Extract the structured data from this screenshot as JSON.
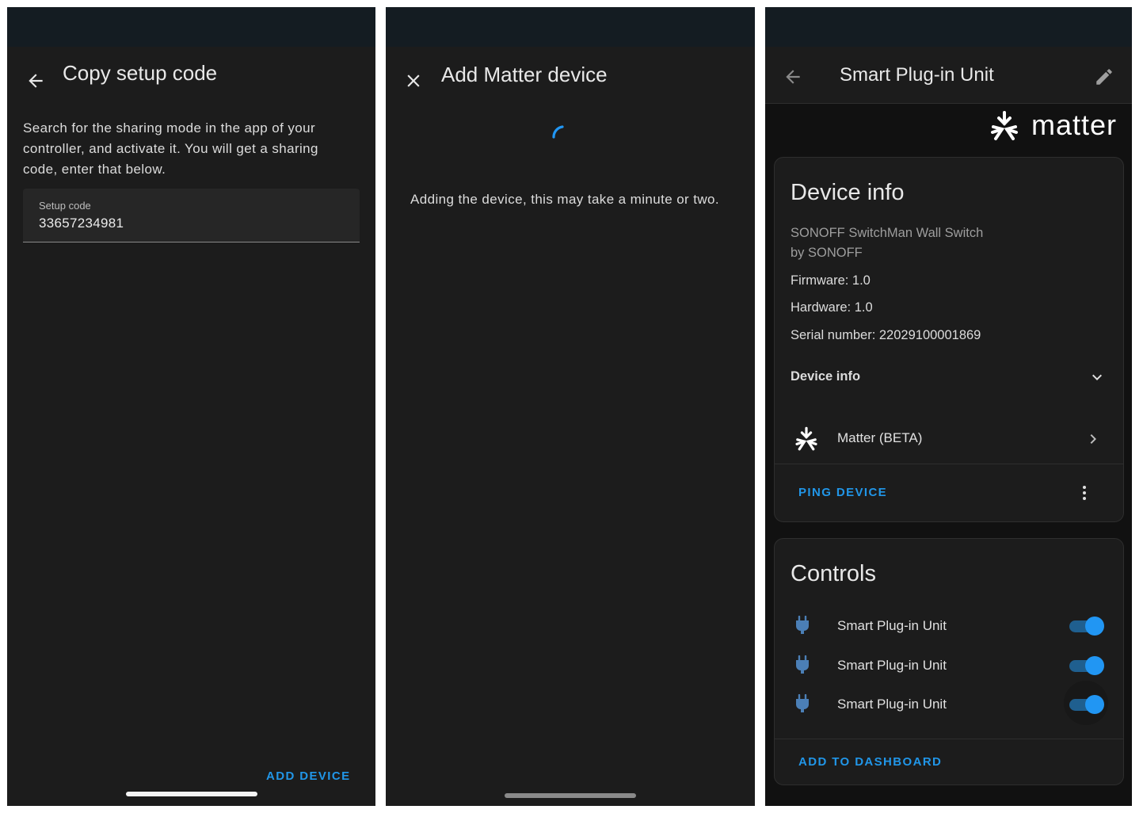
{
  "screen1": {
    "title": "Copy setup code",
    "description": "Search for the sharing mode in the app of your controller, and activate it. You will get a sharing code, enter that below.",
    "setup_code_label": "Setup code",
    "setup_code_value": "33657234981",
    "add_device_label": "ADD DEVICE"
  },
  "screen2": {
    "title": "Add Matter device",
    "message": "Adding the device, this may take a minute or two."
  },
  "screen3": {
    "title": "Smart Plug-in Unit",
    "brand_logo_text": "matter",
    "device_info": {
      "heading": "Device info",
      "model": "SONOFF SwitchMan Wall Switch",
      "manufacturer": "by SONOFF",
      "firmware": "Firmware: 1.0",
      "hardware": "Hardware: 1.0",
      "serial": "Serial number: 22029100001869",
      "expander_label": "Device info",
      "integration_label": "Matter (BETA)",
      "ping_label": "PING DEVICE"
    },
    "controls": {
      "heading": "Controls",
      "items": [
        {
          "label": "Smart Plug-in Unit",
          "on": true
        },
        {
          "label": "Smart Plug-in Unit",
          "on": true
        },
        {
          "label": "Smart Plug-in Unit",
          "on": true
        }
      ],
      "add_to_dashboard_label": "ADD TO DASHBOARD"
    }
  },
  "colors": {
    "accent": "#2196e8",
    "background": "#1c1c1c",
    "statusbar": "#141c22"
  }
}
